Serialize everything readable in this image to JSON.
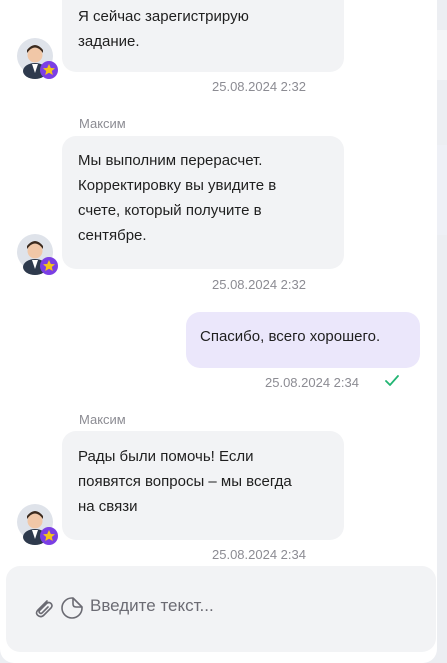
{
  "messages": {
    "m1": {
      "text_line1": "Я сейчас зарегистрирую",
      "text_line2": "задание.",
      "time": "25.08.2024 2:32"
    },
    "m2": {
      "sender": "Максим",
      "lines": [
        "Мы выполним перерасчет.",
        "Корректировку вы увидите в",
        "счете, который получите в",
        "сентябре."
      ],
      "time": "25.08.2024 2:32"
    },
    "m3": {
      "text": "Спасибо, всего хорошего.",
      "time": "25.08.2024 2:34"
    },
    "m4": {
      "sender": "Максим",
      "lines": [
        "Рады были помочь! Если",
        "появятся вопросы – мы всегда",
        "на связи"
      ],
      "time": "25.08.2024 2:34"
    }
  },
  "input": {
    "placeholder": "Введите текст..."
  },
  "colors": {
    "outgoing_bubble": "#ebe7fb",
    "incoming_bubble": "#f2f3f5",
    "check": "#22b573",
    "badge": "#7b3fe4",
    "badge_star": "#f5c518"
  }
}
